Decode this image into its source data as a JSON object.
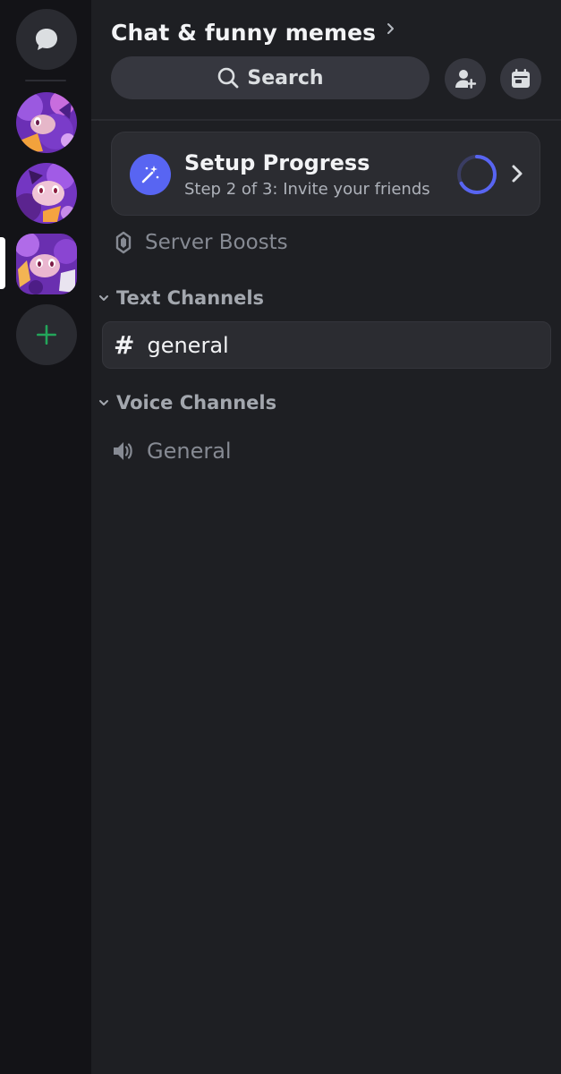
{
  "server": {
    "name": "Chat & funny memes"
  },
  "search": {
    "label": "Search"
  },
  "setup": {
    "title": "Setup Progress",
    "subtitle": "Step 2 of 3: Invite your friends",
    "progress_fraction": 0.667,
    "accent": "#5865f2"
  },
  "server_boosts": {
    "label": "Server Boosts"
  },
  "categories": {
    "text": {
      "label": "Text Channels",
      "channels": [
        {
          "label": "general",
          "icon": "hash-icon",
          "selected": true
        }
      ]
    },
    "voice": {
      "label": "Voice Channels",
      "channels": [
        {
          "label": "General",
          "icon": "speaker-icon"
        }
      ]
    }
  },
  "colors": {
    "rail_bg": "#131317",
    "panel_bg": "#1e1f23",
    "add_green": "#23a55a",
    "muted_text": "#868a93"
  }
}
